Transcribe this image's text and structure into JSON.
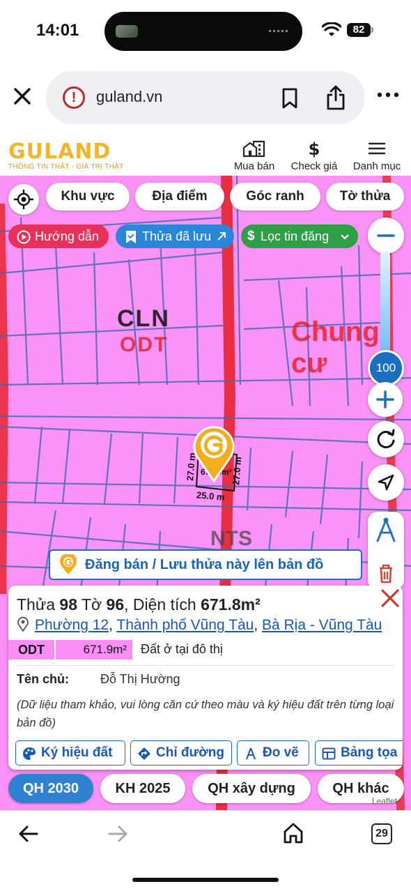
{
  "status": {
    "time": "14:01",
    "battery": "82"
  },
  "browser": {
    "url": "guland.vn",
    "open_tabs": "29"
  },
  "header": {
    "logo": "GULAND",
    "tagline": "THÔNG TIN THẬT - GIÁ TRỊ THẬT",
    "nav": [
      {
        "label": "Mua bán",
        "icon": "buildings-icon"
      },
      {
        "label": "Check giá",
        "icon": "dollar-icon"
      },
      {
        "label": "Danh mục",
        "icon": "menu-icon"
      }
    ]
  },
  "map": {
    "filters": [
      "Khu vực",
      "Địa điểm",
      "Góc ranh",
      "Tờ thửa"
    ],
    "tags": {
      "guide": "Hướng dẫn",
      "saved": "Thửa đã lưu",
      "filter": "Lọc tin đăng"
    },
    "zoom_level": "100",
    "labels": {
      "cln": "CLN",
      "odt": "ODT",
      "chung_cu": "Chung cư",
      "nts": "NTS"
    },
    "measurements": {
      "left": "27.0 m",
      "right": "27.0 m",
      "bottom": "25.0 m",
      "area": "671.9m²"
    },
    "post_bar": "Đăng bán / Lưu thửa này lên bản đồ",
    "attribution": "Leaflet"
  },
  "colors": {
    "land_pink": "#fb92f7",
    "road_red": "#e8242e",
    "brand_gold": "#f2b52a",
    "link_blue": "#1a58b8",
    "tag_red": "#e8305a",
    "tag_blue": "#2a86d9",
    "tag_green": "#2e9e47"
  },
  "card": {
    "parcel_label": "Thửa",
    "parcel_no": "98",
    "sheet_label": "Tờ",
    "sheet_no": "96",
    "area_label": ", Diện tích",
    "area": "671.8m²",
    "ward": "Phường 12",
    "city": "Thành phố Vũng Tàu",
    "province": "Bà Rịa - Vũng Tàu",
    "land_code": "ODT",
    "land_area": "671.9m²",
    "land_desc": "Đất ở tại đô thị",
    "owner_label": "Tên chủ:",
    "owner_name": "Đỗ Thị Hường",
    "note": "(Dữ liệu tham khảo, vui lòng căn cứ theo màu và ký hiệu đất trên từng loại bản đồ)",
    "actions": [
      "Ký hiệu đất",
      "Chỉ đường",
      "Đo vẽ",
      "Bảng tọa"
    ]
  },
  "plan_tabs": [
    "QH 2030",
    "KH 2025",
    "QH xây dựng",
    "QH khác"
  ]
}
